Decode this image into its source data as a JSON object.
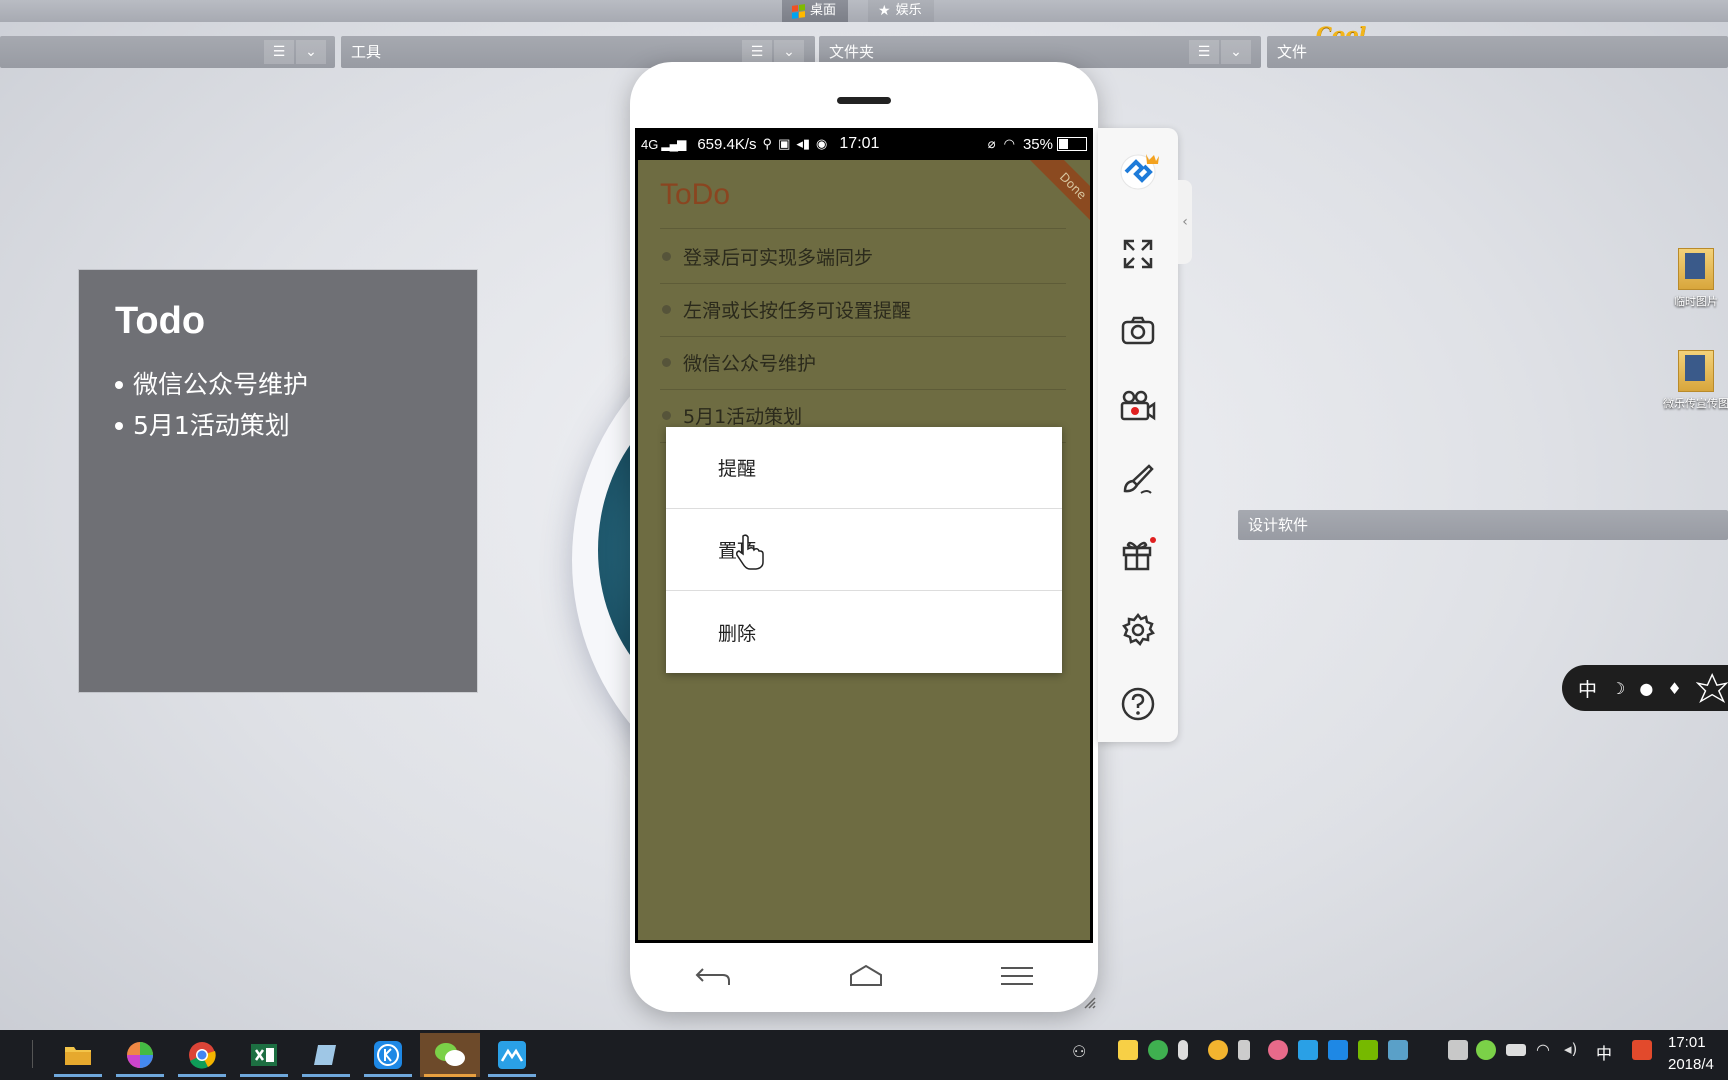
{
  "top_tabs": [
    {
      "label": "桌面",
      "active": true
    },
    {
      "label": "娱乐",
      "active": false
    }
  ],
  "cool_sticker": "Cool",
  "fences": {
    "tools": "工具",
    "folders": "文件夹",
    "files": "文件",
    "design_software": "设计软件"
  },
  "todo_card": {
    "title": "Todo",
    "items": [
      "微信公众号维护",
      "5月1活动策划"
    ]
  },
  "phone": {
    "status_bar": {
      "network": "4G",
      "speed": "659.4K/s",
      "time": "17:01",
      "battery": "35%"
    },
    "app": {
      "title": "ToDo",
      "ribbon": "Done",
      "tasks": [
        "登录后可实现多端同步",
        "左滑或长按任务可设置提醒",
        "微信公众号维护",
        "5月1活动策划"
      ]
    },
    "context_menu": [
      "提醒",
      "置顶",
      "删除"
    ]
  },
  "tool_panel": {
    "tools": [
      "fullscreen-icon",
      "screenshot-icon",
      "record-icon",
      "brush-icon",
      "gift-icon",
      "settings-icon",
      "help-icon"
    ]
  },
  "desktop_icons": [
    {
      "label": "临时图片"
    },
    {
      "label": "微乐传宣传图"
    }
  ],
  "ime_bar": {
    "mode": "中"
  },
  "taskbar": {
    "time": "17:01",
    "date": "2018/4",
    "tray_lang": "中"
  },
  "colors": {
    "app_bg": "#6e6c42",
    "app_title": "#8a4520",
    "card_bg": "#6f7075",
    "taskbar_bg": "#1b1d22"
  }
}
